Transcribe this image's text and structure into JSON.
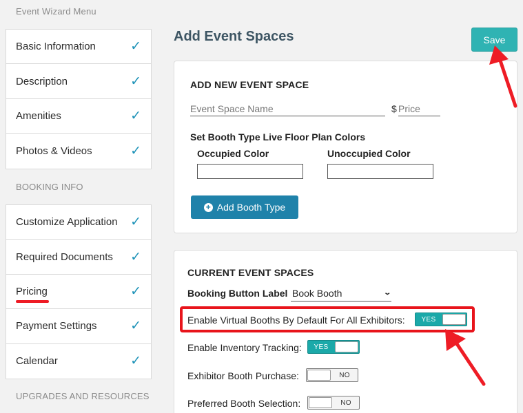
{
  "sidebar": {
    "wizard_title": "Event Wizard Menu",
    "group1": [
      {
        "label": "Basic Information",
        "check": "✓"
      },
      {
        "label": "Description",
        "check": "✓"
      },
      {
        "label": "Amenities",
        "check": "✓"
      },
      {
        "label": "Photos & Videos",
        "check": "✓"
      }
    ],
    "booking_title": "BOOKING INFO",
    "group2": [
      {
        "label": "Customize Application",
        "check": "✓"
      },
      {
        "label": "Required Documents",
        "check": "✓"
      },
      {
        "label": "Pricing",
        "check": "✓"
      },
      {
        "label": "Payment Settings",
        "check": "✓"
      },
      {
        "label": "Calendar",
        "check": "✓"
      }
    ],
    "upgrades_title": "UPGRADES AND RESOURCES"
  },
  "main": {
    "title": "Add Event Spaces",
    "save_label": "Save"
  },
  "add_space": {
    "heading": "ADD NEW EVENT SPACE",
    "name_placeholder": "Event Space Name",
    "dollar": "$",
    "price_placeholder": "Price",
    "colors_heading": "Set Booth Type Live Floor Plan Colors",
    "occupied_label": "Occupied Color",
    "unoccupied_label": "Unoccupied Color",
    "add_button_label": "Add Booth Type"
  },
  "current_spaces": {
    "heading": "CURRENT EVENT SPACES",
    "booking_label": "Booking Button Label",
    "booking_value": "Book Booth",
    "virtual_label": "Enable Virtual Booths By Default For All Exhibitors:",
    "virtual_toggle": "YES",
    "inventory_label": "Enable Inventory Tracking:",
    "inventory_toggle": "YES",
    "purchase_label": "Exhibitor Booth Purchase:",
    "purchase_toggle": "NO",
    "preferred_label": "Preferred Booth Selection:",
    "preferred_toggle": "NO"
  },
  "colors": {
    "accent_teal": "#2fb3b3",
    "button_blue": "#1f82aa",
    "check_blue": "#1e93b8",
    "annotation_red": "#e8141b"
  }
}
